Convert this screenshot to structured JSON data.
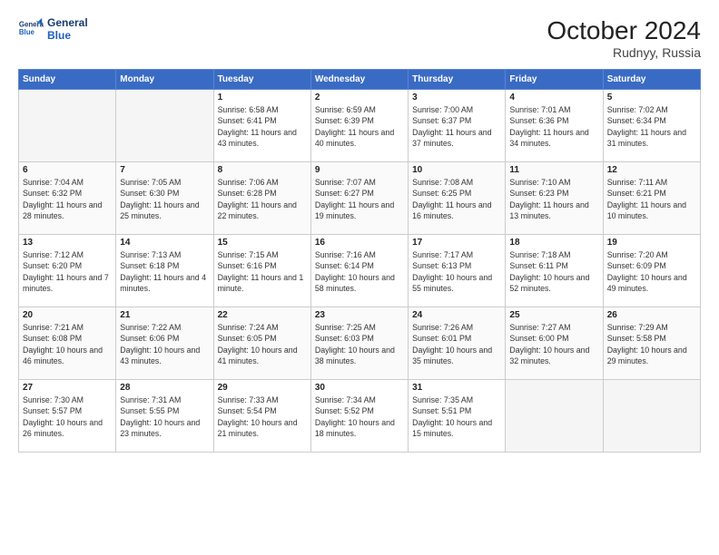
{
  "header": {
    "logo_line1": "General",
    "logo_line2": "Blue",
    "month": "October 2024",
    "location": "Rudnyy, Russia"
  },
  "weekdays": [
    "Sunday",
    "Monday",
    "Tuesday",
    "Wednesday",
    "Thursday",
    "Friday",
    "Saturday"
  ],
  "weeks": [
    [
      {
        "day": "",
        "sunrise": "",
        "sunset": "",
        "daylight": ""
      },
      {
        "day": "",
        "sunrise": "",
        "sunset": "",
        "daylight": ""
      },
      {
        "day": "1",
        "sunrise": "Sunrise: 6:58 AM",
        "sunset": "Sunset: 6:41 PM",
        "daylight": "Daylight: 11 hours and 43 minutes."
      },
      {
        "day": "2",
        "sunrise": "Sunrise: 6:59 AM",
        "sunset": "Sunset: 6:39 PM",
        "daylight": "Daylight: 11 hours and 40 minutes."
      },
      {
        "day": "3",
        "sunrise": "Sunrise: 7:00 AM",
        "sunset": "Sunset: 6:37 PM",
        "daylight": "Daylight: 11 hours and 37 minutes."
      },
      {
        "day": "4",
        "sunrise": "Sunrise: 7:01 AM",
        "sunset": "Sunset: 6:36 PM",
        "daylight": "Daylight: 11 hours and 34 minutes."
      },
      {
        "day": "5",
        "sunrise": "Sunrise: 7:02 AM",
        "sunset": "Sunset: 6:34 PM",
        "daylight": "Daylight: 11 hours and 31 minutes."
      }
    ],
    [
      {
        "day": "6",
        "sunrise": "Sunrise: 7:04 AM",
        "sunset": "Sunset: 6:32 PM",
        "daylight": "Daylight: 11 hours and 28 minutes."
      },
      {
        "day": "7",
        "sunrise": "Sunrise: 7:05 AM",
        "sunset": "Sunset: 6:30 PM",
        "daylight": "Daylight: 11 hours and 25 minutes."
      },
      {
        "day": "8",
        "sunrise": "Sunrise: 7:06 AM",
        "sunset": "Sunset: 6:28 PM",
        "daylight": "Daylight: 11 hours and 22 minutes."
      },
      {
        "day": "9",
        "sunrise": "Sunrise: 7:07 AM",
        "sunset": "Sunset: 6:27 PM",
        "daylight": "Daylight: 11 hours and 19 minutes."
      },
      {
        "day": "10",
        "sunrise": "Sunrise: 7:08 AM",
        "sunset": "Sunset: 6:25 PM",
        "daylight": "Daylight: 11 hours and 16 minutes."
      },
      {
        "day": "11",
        "sunrise": "Sunrise: 7:10 AM",
        "sunset": "Sunset: 6:23 PM",
        "daylight": "Daylight: 11 hours and 13 minutes."
      },
      {
        "day": "12",
        "sunrise": "Sunrise: 7:11 AM",
        "sunset": "Sunset: 6:21 PM",
        "daylight": "Daylight: 11 hours and 10 minutes."
      }
    ],
    [
      {
        "day": "13",
        "sunrise": "Sunrise: 7:12 AM",
        "sunset": "Sunset: 6:20 PM",
        "daylight": "Daylight: 11 hours and 7 minutes."
      },
      {
        "day": "14",
        "sunrise": "Sunrise: 7:13 AM",
        "sunset": "Sunset: 6:18 PM",
        "daylight": "Daylight: 11 hours and 4 minutes."
      },
      {
        "day": "15",
        "sunrise": "Sunrise: 7:15 AM",
        "sunset": "Sunset: 6:16 PM",
        "daylight": "Daylight: 11 hours and 1 minute."
      },
      {
        "day": "16",
        "sunrise": "Sunrise: 7:16 AM",
        "sunset": "Sunset: 6:14 PM",
        "daylight": "Daylight: 10 hours and 58 minutes."
      },
      {
        "day": "17",
        "sunrise": "Sunrise: 7:17 AM",
        "sunset": "Sunset: 6:13 PM",
        "daylight": "Daylight: 10 hours and 55 minutes."
      },
      {
        "day": "18",
        "sunrise": "Sunrise: 7:18 AM",
        "sunset": "Sunset: 6:11 PM",
        "daylight": "Daylight: 10 hours and 52 minutes."
      },
      {
        "day": "19",
        "sunrise": "Sunrise: 7:20 AM",
        "sunset": "Sunset: 6:09 PM",
        "daylight": "Daylight: 10 hours and 49 minutes."
      }
    ],
    [
      {
        "day": "20",
        "sunrise": "Sunrise: 7:21 AM",
        "sunset": "Sunset: 6:08 PM",
        "daylight": "Daylight: 10 hours and 46 minutes."
      },
      {
        "day": "21",
        "sunrise": "Sunrise: 7:22 AM",
        "sunset": "Sunset: 6:06 PM",
        "daylight": "Daylight: 10 hours and 43 minutes."
      },
      {
        "day": "22",
        "sunrise": "Sunrise: 7:24 AM",
        "sunset": "Sunset: 6:05 PM",
        "daylight": "Daylight: 10 hours and 41 minutes."
      },
      {
        "day": "23",
        "sunrise": "Sunrise: 7:25 AM",
        "sunset": "Sunset: 6:03 PM",
        "daylight": "Daylight: 10 hours and 38 minutes."
      },
      {
        "day": "24",
        "sunrise": "Sunrise: 7:26 AM",
        "sunset": "Sunset: 6:01 PM",
        "daylight": "Daylight: 10 hours and 35 minutes."
      },
      {
        "day": "25",
        "sunrise": "Sunrise: 7:27 AM",
        "sunset": "Sunset: 6:00 PM",
        "daylight": "Daylight: 10 hours and 32 minutes."
      },
      {
        "day": "26",
        "sunrise": "Sunrise: 7:29 AM",
        "sunset": "Sunset: 5:58 PM",
        "daylight": "Daylight: 10 hours and 29 minutes."
      }
    ],
    [
      {
        "day": "27",
        "sunrise": "Sunrise: 7:30 AM",
        "sunset": "Sunset: 5:57 PM",
        "daylight": "Daylight: 10 hours and 26 minutes."
      },
      {
        "day": "28",
        "sunrise": "Sunrise: 7:31 AM",
        "sunset": "Sunset: 5:55 PM",
        "daylight": "Daylight: 10 hours and 23 minutes."
      },
      {
        "day": "29",
        "sunrise": "Sunrise: 7:33 AM",
        "sunset": "Sunset: 5:54 PM",
        "daylight": "Daylight: 10 hours and 21 minutes."
      },
      {
        "day": "30",
        "sunrise": "Sunrise: 7:34 AM",
        "sunset": "Sunset: 5:52 PM",
        "daylight": "Daylight: 10 hours and 18 minutes."
      },
      {
        "day": "31",
        "sunrise": "Sunrise: 7:35 AM",
        "sunset": "Sunset: 5:51 PM",
        "daylight": "Daylight: 10 hours and 15 minutes."
      },
      {
        "day": "",
        "sunrise": "",
        "sunset": "",
        "daylight": ""
      },
      {
        "day": "",
        "sunrise": "",
        "sunset": "",
        "daylight": ""
      }
    ]
  ]
}
